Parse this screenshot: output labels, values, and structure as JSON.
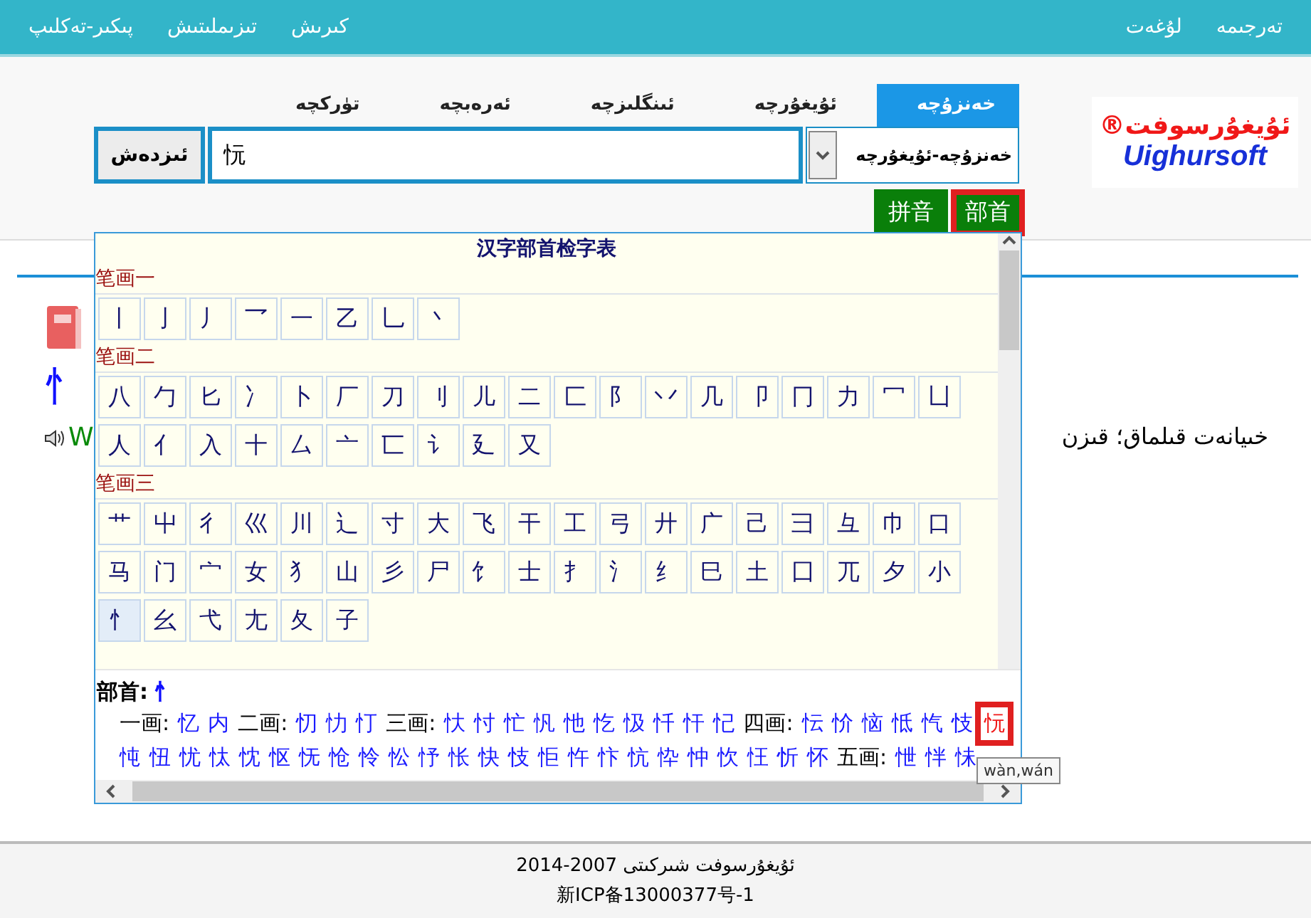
{
  "top_bar": {
    "left_links": [
      "كىرىش",
      "تىزىملىتىش",
      "پىكىر-تەكلىپ"
    ],
    "right_links": [
      "تەرجىمە",
      "لۇغەت"
    ]
  },
  "tabs": [
    {
      "label": "خەنزۇچە",
      "selected": true
    },
    {
      "label": "ئۇيغۇرچە",
      "selected": false
    },
    {
      "label": "ئىنگلىزچە",
      "selected": false
    },
    {
      "label": "ئەرەبچە",
      "selected": false
    },
    {
      "label": "تۈركچە",
      "selected": false
    }
  ],
  "search": {
    "button": "ئىزدەش",
    "value": "忨",
    "direction": "خەنزۇچە-ئۇيغۇرچە"
  },
  "logo": {
    "name": "ئۇيغۇرسوفت",
    "mark": "®",
    "latin": "Uighursoft"
  },
  "lookup_modes": [
    {
      "label": "部首",
      "selected": true
    },
    {
      "label": "拼音",
      "selected": false
    }
  ],
  "entry": {
    "headword": "忄",
    "pinyin": "W",
    "definition": "خىيانەت قىلماق؛ قىزن"
  },
  "radical_table": {
    "title": "汉字部首检字表",
    "sections": [
      {
        "label": "笔画一",
        "rows": [
          [
            null,
            null,
            null,
            null,
            null,
            null,
            null,
            null,
            null,
            null,
            null,
            {
              "c": "丶",
              "selected": false
            },
            {
              "c": "乚",
              "selected": false
            },
            {
              "c": "乙",
              "selected": false
            },
            {
              "c": "一",
              "selected": false
            },
            {
              "c": "乛",
              "selected": false
            },
            {
              "c": "丿",
              "selected": false
            },
            {
              "c": "亅",
              "selected": false
            },
            {
              "c": "丨",
              "selected": false
            }
          ]
        ]
      },
      {
        "label": "笔画二",
        "rows": [
          [
            {
              "c": "凵",
              "selected": false
            },
            {
              "c": "冖",
              "selected": false
            },
            {
              "c": "力",
              "selected": false
            },
            {
              "c": "冂",
              "selected": false
            },
            {
              "c": "卩",
              "selected": false
            },
            {
              "c": "几",
              "selected": false
            },
            {
              "c": "丷",
              "selected": false
            },
            {
              "c": "阝",
              "selected": false
            },
            {
              "c": "匚",
              "selected": false
            },
            {
              "c": "二",
              "selected": false
            },
            {
              "c": "儿",
              "selected": false
            },
            {
              "c": "刂",
              "selected": false
            },
            {
              "c": "刀",
              "selected": false
            },
            {
              "c": "厂",
              "selected": false
            },
            {
              "c": "卜",
              "selected": false
            },
            {
              "c": "冫",
              "selected": false
            },
            {
              "c": "匕",
              "selected": false
            },
            {
              "c": "勹",
              "selected": false
            },
            {
              "c": "八",
              "selected": false
            }
          ],
          [
            null,
            null,
            null,
            null,
            null,
            null,
            null,
            null,
            null,
            {
              "c": "又",
              "selected": false
            },
            {
              "c": "廴",
              "selected": false
            },
            {
              "c": "讠",
              "selected": false
            },
            {
              "c": "匸",
              "selected": false
            },
            {
              "c": "亠",
              "selected": false
            },
            {
              "c": "厶",
              "selected": false
            },
            {
              "c": "十",
              "selected": false
            },
            {
              "c": "入",
              "selected": false
            },
            {
              "c": "亻",
              "selected": false
            },
            {
              "c": "人",
              "selected": false
            }
          ]
        ]
      },
      {
        "label": "笔画三",
        "rows": [
          [
            {
              "c": "口",
              "selected": false
            },
            {
              "c": "巾",
              "selected": false
            },
            {
              "c": "彑",
              "selected": false
            },
            {
              "c": "彐",
              "selected": false
            },
            {
              "c": "己",
              "selected": false
            },
            {
              "c": "广",
              "selected": false
            },
            {
              "c": "廾",
              "selected": false
            },
            {
              "c": "弓",
              "selected": false
            },
            {
              "c": "工",
              "selected": false
            },
            {
              "c": "干",
              "selected": false
            },
            {
              "c": "飞",
              "selected": false
            },
            {
              "c": "大",
              "selected": false
            },
            {
              "c": "寸",
              "selected": false
            },
            {
              "c": "辶",
              "selected": false
            },
            {
              "c": "川",
              "selected": false
            },
            {
              "c": "巛",
              "selected": false
            },
            {
              "c": "彳",
              "selected": false
            },
            {
              "c": "屮",
              "selected": false
            },
            {
              "c": "艹",
              "selected": false
            }
          ],
          [
            {
              "c": "小",
              "selected": false
            },
            {
              "c": "夕",
              "selected": false
            },
            {
              "c": "兀",
              "selected": false
            },
            {
              "c": "囗",
              "selected": false
            },
            {
              "c": "土",
              "selected": false
            },
            {
              "c": "巳",
              "selected": false
            },
            {
              "c": "纟",
              "selected": false
            },
            {
              "c": "氵",
              "selected": false
            },
            {
              "c": "扌",
              "selected": false
            },
            {
              "c": "士",
              "selected": false
            },
            {
              "c": "饣",
              "selected": false
            },
            {
              "c": "尸",
              "selected": false
            },
            {
              "c": "彡",
              "selected": false
            },
            {
              "c": "山",
              "selected": false
            },
            {
              "c": "犭",
              "selected": false
            },
            {
              "c": "女",
              "selected": false
            },
            {
              "c": "宀",
              "selected": false
            },
            {
              "c": "门",
              "selected": false
            },
            {
              "c": "马",
              "selected": false
            }
          ],
          [
            null,
            null,
            null,
            null,
            null,
            null,
            null,
            null,
            null,
            null,
            null,
            null,
            null,
            {
              "c": "子",
              "selected": false
            },
            {
              "c": "夂",
              "selected": false
            },
            {
              "c": "尢",
              "selected": false
            },
            {
              "c": "弋",
              "selected": false
            },
            {
              "c": "幺",
              "selected": false
            },
            {
              "c": "忄",
              "selected": true
            }
          ]
        ]
      }
    ]
  },
  "result": {
    "label": "部首:",
    "radical": "忄",
    "lines": [
      [
        {
          "kind": "char",
          "t": "忨",
          "selected": true
        },
        {
          "kind": "char",
          "t": "忮",
          "selected": false
        },
        {
          "kind": "char",
          "t": "忾",
          "selected": false
        },
        {
          "kind": "char",
          "t": "怟",
          "selected": false
        },
        {
          "kind": "char",
          "t": "恼",
          "selected": false
        },
        {
          "kind": "char",
          "t": "忦",
          "selected": false
        },
        {
          "kind": "char",
          "t": "忶",
          "selected": false
        },
        {
          "kind": "stroke",
          "t": "四画:"
        },
        {
          "kind": "char",
          "t": "忋",
          "selected": false
        },
        {
          "kind": "char",
          "t": "忓",
          "selected": false
        },
        {
          "kind": "char",
          "t": "忏",
          "selected": false
        },
        {
          "kind": "char",
          "t": "忣",
          "selected": false
        },
        {
          "kind": "char",
          "t": "忔",
          "selected": false
        },
        {
          "kind": "char",
          "t": "忚",
          "selected": false
        },
        {
          "kind": "char",
          "t": "忛",
          "selected": false
        },
        {
          "kind": "char",
          "t": "忙",
          "selected": false
        },
        {
          "kind": "char",
          "t": "忖",
          "selected": false
        },
        {
          "kind": "char",
          "t": "忕",
          "selected": false
        },
        {
          "kind": "stroke",
          "t": "三画:"
        },
        {
          "kind": "char",
          "t": "忊",
          "selected": false
        },
        {
          "kind": "char",
          "t": "忇",
          "selected": false
        },
        {
          "kind": "char",
          "t": "忉",
          "selected": false
        },
        {
          "kind": "stroke",
          "t": "二画:"
        },
        {
          "kind": "char",
          "t": "内",
          "selected": false
        },
        {
          "kind": "char",
          "t": "忆",
          "selected": false
        },
        {
          "kind": "stroke",
          "t": "一画:"
        }
      ],
      [
        {
          "kind": "char",
          "t": "怽",
          "selected": false
        },
        {
          "kind": "char",
          "t": "怑",
          "selected": false
        },
        {
          "kind": "char",
          "t": "怈",
          "selected": false
        },
        {
          "kind": "stroke",
          "t": "五画:"
        },
        {
          "kind": "char",
          "t": "怀",
          "selected": false
        },
        {
          "kind": "char",
          "t": "忻",
          "selected": false
        },
        {
          "kind": "char",
          "t": "忹",
          "selected": false
        },
        {
          "kind": "char",
          "t": "忺",
          "selected": false
        },
        {
          "kind": "char",
          "t": "忡",
          "selected": false
        },
        {
          "kind": "char",
          "t": "忰",
          "selected": false
        },
        {
          "kind": "char",
          "t": "忼",
          "selected": false
        },
        {
          "kind": "char",
          "t": "忭",
          "selected": false
        },
        {
          "kind": "char",
          "t": "忤",
          "selected": false
        },
        {
          "kind": "char",
          "t": "怇",
          "selected": false
        },
        {
          "kind": "char",
          "t": "忮",
          "selected": false
        },
        {
          "kind": "char",
          "t": "快",
          "selected": false
        },
        {
          "kind": "char",
          "t": "怅",
          "selected": false
        },
        {
          "kind": "char",
          "t": "忬",
          "selected": false
        },
        {
          "kind": "char",
          "t": "忪",
          "selected": false
        },
        {
          "kind": "char",
          "t": "怜",
          "selected": false
        },
        {
          "kind": "char",
          "t": "怆",
          "selected": false
        },
        {
          "kind": "char",
          "t": "怃",
          "selected": false
        },
        {
          "kind": "char",
          "t": "怄",
          "selected": false
        },
        {
          "kind": "char",
          "t": "忱",
          "selected": false
        },
        {
          "kind": "char",
          "t": "忲",
          "selected": false
        },
        {
          "kind": "char",
          "t": "忧",
          "selected": false
        },
        {
          "kind": "char",
          "t": "忸",
          "selected": false
        },
        {
          "kind": "char",
          "t": "忳",
          "selected": false
        }
      ]
    ]
  },
  "tooltip": "wàn,wán",
  "footer": {
    "copyright": "ئۇيغۇرسوفت شىركىتى 2007-2014",
    "icp": "新ICP备13000377号-1"
  }
}
